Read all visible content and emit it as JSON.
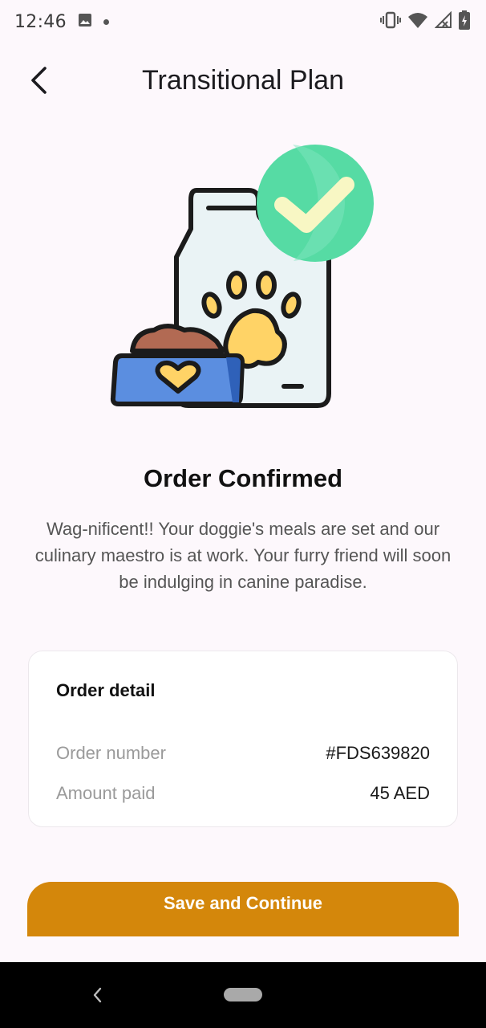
{
  "status_bar": {
    "time": "12:46",
    "icons": [
      "image-icon",
      "dot-icon",
      "vibrate-icon",
      "wifi-icon",
      "signal-icon",
      "battery-icon"
    ]
  },
  "app_bar": {
    "back_icon": "back-arrow-icon",
    "title": "Transitional Plan"
  },
  "illustration": {
    "name": "dog-food-order-confirmed-illustration",
    "colors": {
      "bag": "#eaf3f5",
      "check_circle": "#2fd28a",
      "bowl": "#5b8ee0",
      "paw": "#ffd366"
    }
  },
  "confirmation": {
    "title": "Order Confirmed",
    "message": "Wag-nificent!! Your doggie's meals are set and our culinary maestro is at work. Your furry friend will soon be indulging in canine paradise."
  },
  "order_detail": {
    "title": "Order detail",
    "rows": [
      {
        "label": "Order number",
        "value": "#FDS639820"
      },
      {
        "label": "Amount paid",
        "value": "45 AED"
      }
    ]
  },
  "primary_action": {
    "label": "Save and Continue",
    "color": "#d4870b"
  },
  "nav_bar": {
    "icons": [
      "nav-back-icon",
      "home-pill-icon"
    ]
  }
}
